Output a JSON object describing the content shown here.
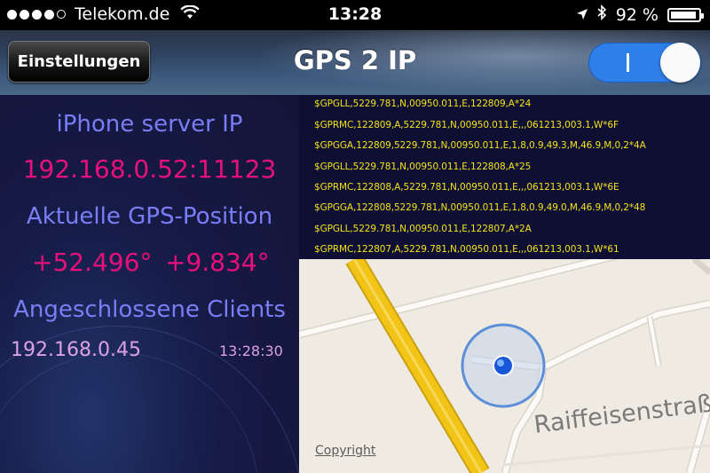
{
  "status_bar": {
    "carrier": "Telekom.de",
    "time": "13:28",
    "battery_text": "92 %",
    "battery_level": 0.92,
    "icons": [
      "signal-dots",
      "wifi-icon",
      "location-arrow-icon",
      "bluetooth-icon",
      "battery-icon"
    ]
  },
  "nav": {
    "settings_label": "Einstellungen",
    "title": "GPS 2 IP",
    "toggle_state": "on",
    "toggle_text": "I"
  },
  "info": {
    "server_label": "iPhone server IP",
    "server_value": "192.168.0.52:11123",
    "gps_label": "Aktuelle GPS-Position",
    "lat": "+52.496°",
    "lon": "+9.834°",
    "clients_label": "Angeschlossene Clients",
    "client_ip": "192.168.0.45",
    "client_time": "13:28:30"
  },
  "nmea": [
    "$GPGLL,5229.781,N,00950.011,E,122809,A*24",
    "$GPRMC,122809,A,5229.781,N,00950.011,E,,,061213,003.1,W*6F",
    "$GPGGA,122809,5229.781,N,00950.011,E,1,8,0.9,49.3,M,46.9,M,0,2*4A",
    "$GPGLL,5229.781,N,00950.011,E,122808,A*25",
    "$GPRMC,122808,A,5229.781,N,00950.011,E,,,061213,003.1,W*6E",
    "$GPGGA,122808,5229.781,N,00950.011,E,1,8,0.9,49.0,M,46.9,M,0,2*48",
    "$GPGLL,5229.781,N,00950.011,E,122807,A*2A",
    "$GPRMC,122807,A,5229.781,N,00950.011,E,,,061213,003.1,W*61"
  ],
  "map": {
    "copyright": "Copyright",
    "street_label": "Raiffeisenstraß"
  },
  "colors": {
    "label": "#7a7ef6",
    "value": "#e8107a",
    "client": "#dda0e6",
    "nmea": "#f4e21a",
    "toggle": "#2f7fea",
    "road_major": "#f2c418"
  }
}
